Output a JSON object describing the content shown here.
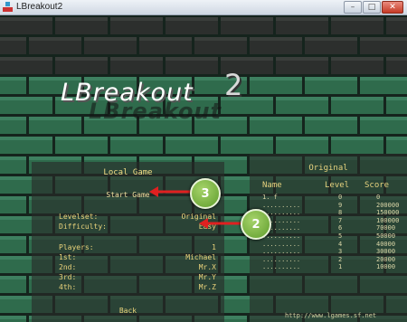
{
  "window": {
    "title": "LBreakout2",
    "minimize": "–",
    "maximize": "□",
    "close": "✕"
  },
  "game": {
    "logo_main": "LBreakout",
    "logo_shadow": "LBreakout",
    "logo_two": "2"
  },
  "menu": {
    "title": "Local Game",
    "start": "Start Game",
    "rows": [
      {
        "label": "Levelset:",
        "value": "Original"
      },
      {
        "label": "Difficulty:",
        "value": "Easy"
      },
      {
        "label": "Players:",
        "value": "1"
      },
      {
        "label": "1st:",
        "value": "Michael"
      },
      {
        "label": "2nd:",
        "value": "Mr.X"
      },
      {
        "label": "3rd:",
        "value": "Mr.Y"
      },
      {
        "label": "4th:",
        "value": "Mr.Z"
      }
    ],
    "back": "Back"
  },
  "highscores": {
    "title": "Original",
    "headers": {
      "name": "Name",
      "level": "Level",
      "score": "Score"
    },
    "rows": [
      {
        "name": "1. f",
        "level": "0",
        "score": "0"
      },
      {
        "name": "..........",
        "level": "9",
        "score": "200000"
      },
      {
        "name": "..........",
        "level": "8",
        "score": "150000"
      },
      {
        "name": "..........",
        "level": "7",
        "score": "100000"
      },
      {
        "name": "..........",
        "level": "6",
        "score": "70000"
      },
      {
        "name": "..........",
        "level": "5",
        "score": "50000"
      },
      {
        "name": "..........",
        "level": "4",
        "score": "40000"
      },
      {
        "name": "..........",
        "level": "3",
        "score": "30000"
      },
      {
        "name": "..........",
        "level": "2",
        "score": "20000"
      },
      {
        "name": "..........",
        "level": "1",
        "score": "10000"
      }
    ],
    "footer": "http://www.lgames.sf.net"
  },
  "callouts": [
    {
      "number": "3"
    },
    {
      "number": "2"
    }
  ],
  "colors": {
    "brick": "#2f6b4c",
    "brick_dark": "#1f4a34",
    "menu_text": "#ead37b",
    "arrow": "#e02020",
    "callout": "#7db544"
  }
}
